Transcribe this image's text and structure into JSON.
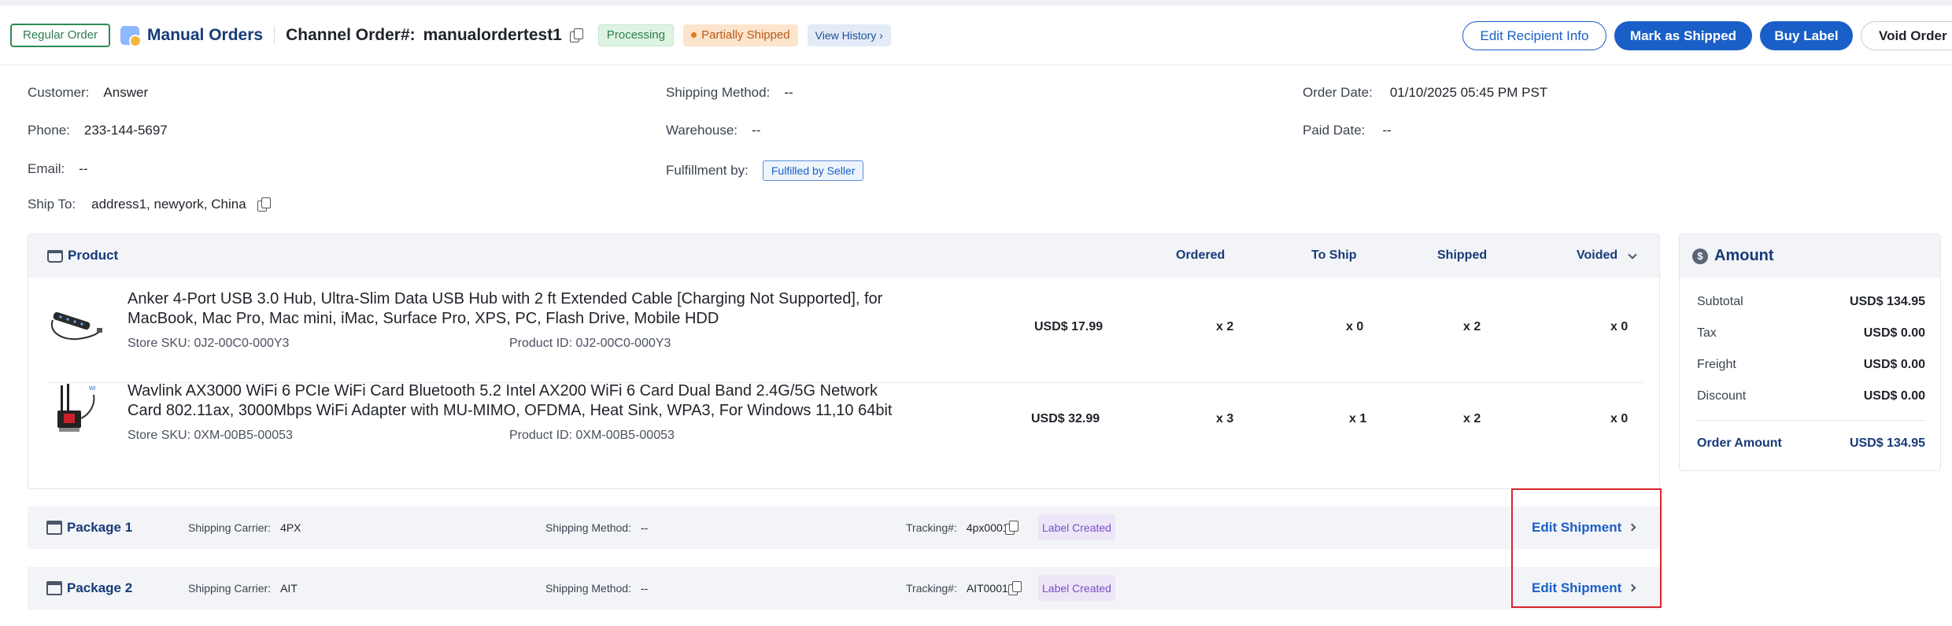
{
  "header": {
    "order_type": "Regular Order",
    "source": "Manual Orders",
    "channel_order_label": "Channel Order#:",
    "channel_order_value": "manualordertest1",
    "status_processing": "Processing",
    "status_shipping": "Partially Shipped",
    "view_history": "View History ›",
    "actions": {
      "edit_recipient": "Edit Recipient Info",
      "mark_shipped": "Mark as Shipped",
      "buy_label": "Buy Label",
      "void_order": "Void Order"
    }
  },
  "info": {
    "customer": {
      "label": "Customer:",
      "value": "Answer"
    },
    "phone": {
      "label": "Phone:",
      "value": "233-144-5697"
    },
    "email": {
      "label": "Email:",
      "value": "--"
    },
    "ship_to": {
      "label": "Ship To:",
      "value": "address1, newyork, China"
    },
    "shipping_method": {
      "label": "Shipping Method:",
      "value": "--"
    },
    "warehouse": {
      "label": "Warehouse:",
      "value": "--"
    },
    "fulfillment": {
      "label": "Fulfillment by:",
      "value": "Fulfilled by Seller"
    },
    "order_date": {
      "label": "Order Date:",
      "value": "01/10/2025 05:45 PM PST"
    },
    "paid_date": {
      "label": "Paid Date:",
      "value": "--"
    }
  },
  "product_table": {
    "columns": {
      "product": "Product",
      "ordered": "Ordered",
      "to_ship": "To Ship",
      "shipped": "Shipped",
      "voided": "Voided"
    },
    "rows": [
      {
        "name": "Anker 4-Port USB 3.0 Hub, Ultra-Slim Data USB Hub with 2 ft Extended Cable [Charging Not Supported], for MacBook, Mac Pro, Mac mini, iMac, Surface Pro, XPS, PC, Flash Drive, Mobile HDD",
        "store_sku": "Store SKU: 0J2-00C0-000Y3",
        "product_id": "Product ID: 0J2-00C0-000Y3",
        "price": "USD$ 17.99",
        "ordered": "x 2",
        "to_ship": "x 0",
        "shipped": "x 2",
        "voided": "x 0"
      },
      {
        "name": "Wavlink AX3000 WiFi 6 PCIe WiFi Card Bluetooth 5.2 Intel AX200 WiFi 6 Card Dual Band 2.4G/5G Network Card 802.11ax, 3000Mbps WiFi Adapter with MU-MIMO, OFDMA, Heat Sink, WPA3, For Windows 11,10 64bit",
        "store_sku": "Store SKU: 0XM-00B5-00053",
        "product_id": "Product ID: 0XM-00B5-00053",
        "price": "USD$ 32.99",
        "ordered": "x 3",
        "to_ship": "x 1",
        "shipped": "x 2",
        "voided": "x 0"
      }
    ]
  },
  "amount": {
    "title": "Amount",
    "subtotal": {
      "label": "Subtotal",
      "value": "USD$ 134.95"
    },
    "tax": {
      "label": "Tax",
      "value": "USD$ 0.00"
    },
    "freight": {
      "label": "Freight",
      "value": "USD$ 0.00"
    },
    "discount": {
      "label": "Discount",
      "value": "USD$ 0.00"
    },
    "order_amount": {
      "label": "Order Amount",
      "value": "USD$ 134.95"
    }
  },
  "packages": [
    {
      "name": "Package 1",
      "carrier_label": "Shipping Carrier:",
      "carrier": "4PX",
      "method_label": "Shipping Method:",
      "method": "--",
      "tracking_label": "Tracking#:",
      "tracking": "4px0001",
      "status": "Label Created",
      "action": "Edit Shipment"
    },
    {
      "name": "Package 2",
      "carrier_label": "Shipping Carrier:",
      "carrier": "AIT",
      "method_label": "Shipping Method:",
      "method": "--",
      "tracking_label": "Tracking#:",
      "tracking": "AIT0001",
      "status": "Label Created",
      "action": "Edit Shipment"
    }
  ],
  "colors": {
    "brand_blue": "#1a5fc8",
    "navy": "#173a78",
    "highlight": "#d6262b"
  }
}
